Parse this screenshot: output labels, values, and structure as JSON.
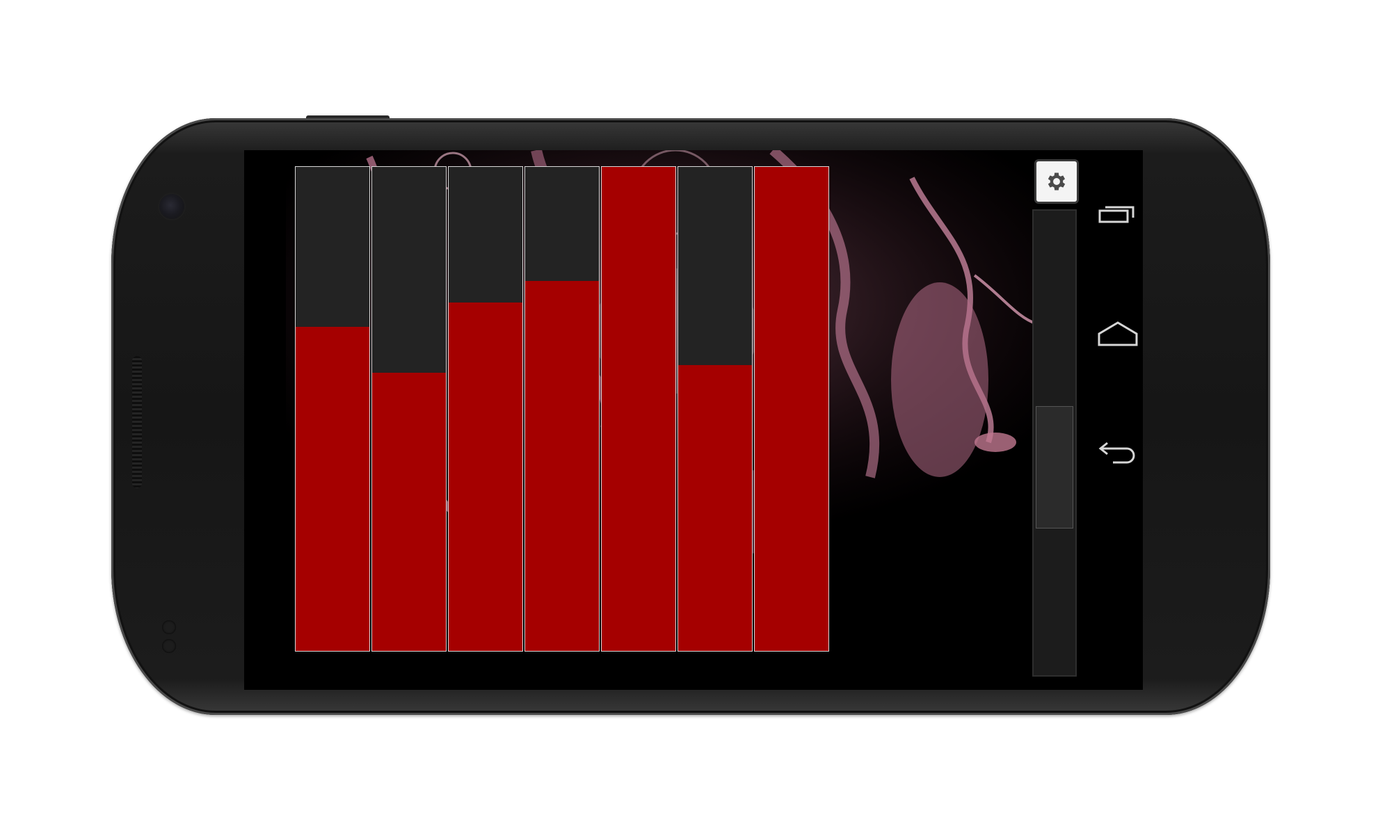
{
  "device": {
    "type": "android-phone",
    "orientation": "landscape"
  },
  "sliders": [
    {
      "id": 1,
      "level": 0.67
    },
    {
      "id": 2,
      "level": 0.575
    },
    {
      "id": 3,
      "level": 0.72
    },
    {
      "id": 4,
      "level": 0.765
    },
    {
      "id": 5,
      "level": 1.0
    },
    {
      "id": 6,
      "level": 0.59
    },
    {
      "id": 7,
      "level": 1.0
    }
  ],
  "colors": {
    "slider_fill": "#a50000",
    "slider_empty": "#232323",
    "slider_border": "#d8d8d8",
    "wallpaper_tint": "#b76a86"
  },
  "side_panel": {
    "settings_icon": "gear-icon",
    "scroll_thumb_position": 0.42,
    "scroll_thumb_size": 0.26
  },
  "navigation_bar": {
    "buttons": [
      {
        "name": "recent-apps",
        "icon": "recent-apps-icon"
      },
      {
        "name": "home",
        "icon": "home-icon"
      },
      {
        "name": "back",
        "icon": "back-icon"
      }
    ]
  }
}
